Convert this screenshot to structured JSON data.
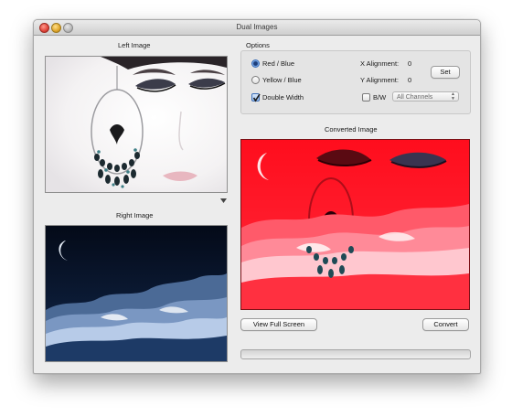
{
  "window": {
    "title": "Dual Images"
  },
  "left_panel": {
    "left_image_label": "Left Image",
    "right_image_label": "Right Image"
  },
  "options": {
    "group_label": "Options",
    "color_modes": [
      {
        "label": "Red / Blue",
        "selected": true
      },
      {
        "label": "Yellow / Blue",
        "selected": false
      }
    ],
    "double_width": {
      "label": "Double Width",
      "checked": true
    },
    "x_alignment": {
      "label": "X Alignment:",
      "value": "0"
    },
    "y_alignment": {
      "label": "Y Alignment:",
      "value": "0"
    },
    "set_button": "Set",
    "bw": {
      "label": "B/W",
      "checked": false
    },
    "channel_select": {
      "value": "All Channels"
    }
  },
  "converted": {
    "label": "Converted Image"
  },
  "buttons": {
    "view_full_screen": "View Full Screen",
    "convert": "Convert"
  },
  "progress": {
    "value": 0
  },
  "colors": {
    "accent": "#3d6fb8",
    "converted_red": "#ff1020",
    "night_sky": "#0a1428"
  }
}
